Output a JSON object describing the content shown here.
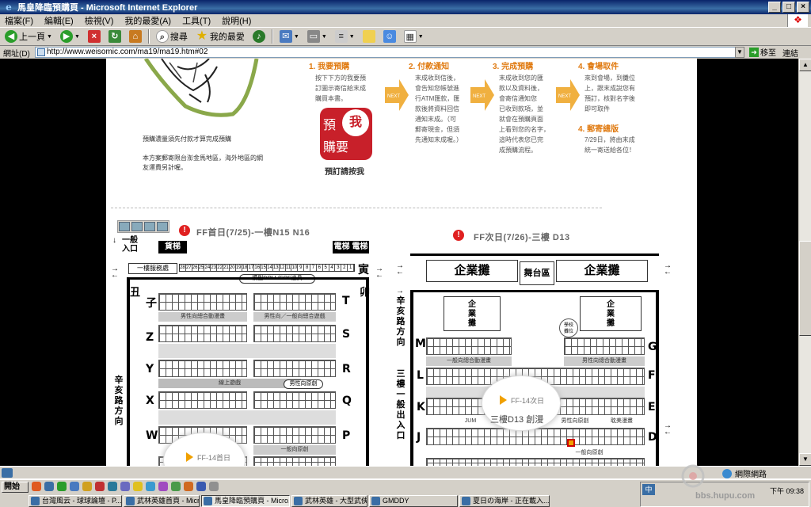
{
  "window": {
    "title": "馬皇降臨預購頁 - Microsoft Internet Explorer",
    "controls": [
      "_",
      "□",
      "×"
    ]
  },
  "menu": [
    "檔案(F)",
    "編輯(E)",
    "檢視(V)",
    "我的最愛(A)",
    "工具(T)",
    "說明(H)"
  ],
  "toolbar": {
    "back": "上一頁",
    "search": "搜尋",
    "favorites": "我的最愛"
  },
  "address": {
    "label": "網址(D)",
    "url": "http://www.weisomic.com/ma19/ma19.htm#02",
    "go": "移至",
    "links": "連結"
  },
  "page": {
    "note1": "預購濃量須先付款才算完成預購",
    "note2_lines": [
      "本方案郵寄限台澎金馬地區，海外地區的網",
      "友運費另計喔。"
    ],
    "steps": [
      {
        "title": "1. 我要預購",
        "lines": [
          "按下下方的我要預",
          "訂圖示寄信給末成",
          "購買本書。"
        ]
      },
      {
        "title": "2. 付款通知",
        "lines": [
          "末成收到信後，",
          "會告知您帳號進",
          "行ATM匯款，匯",
          "款後將資料回信",
          "通知末成。（可",
          "郵寄現金，但須",
          "先通知末成喔。）"
        ]
      },
      {
        "title": "3. 完成預購",
        "lines": [
          "末成收到您的匯",
          "款以及資料後，",
          "會寄信通知您",
          "已收到款項，並",
          "就會在預購頁面",
          "上看到您的名字，",
          "這時代表您已完",
          "成預購流程。"
        ]
      },
      {
        "title": "4. 會場取件",
        "lines": [
          "來到會場，到攤位",
          "上，跟末成說您有",
          "預訂，核對名字後",
          "即可取件"
        ]
      },
      {
        "title": "4. 郵寄總版",
        "lines": [
          "7/29日，將由末成",
          "統一寄送給各位！"
        ]
      }
    ],
    "next_label": "NEXT",
    "stamp": {
      "c1": "預",
      "c2": "我",
      "c3": "購要"
    },
    "stamp_caption": "預訂請按我",
    "floor1": {
      "warn": "!",
      "title": "FF首日(7/25)-一樓N15 N16",
      "entry": [
        "一般",
        "入口"
      ],
      "elevator1": "貨梯",
      "elevator2": "電梯 電梯",
      "service": "一樓服務處",
      "strip_nums": [
        "28",
        "27",
        "26",
        "25",
        "24",
        "23",
        "22",
        "21",
        "20",
        "19",
        "18",
        "17",
        "16",
        "15",
        "14",
        "13",
        "12",
        "11",
        "10",
        "9",
        "8",
        "7",
        "6",
        "5",
        "4",
        "3",
        "2",
        "1"
      ],
      "corner_left": "丑",
      "corner_right": "寅",
      "doll": "模型DOLL/COS道具",
      "street": "辛亥路方向",
      "rows_left": [
        "子",
        "Z",
        "Y",
        "X",
        "W"
      ],
      "rows_right": [
        "T",
        "S",
        "R",
        "Q",
        "P"
      ],
      "corner2": "卯",
      "zones": [
        "男性向總合動漫畫",
        "男性向／一般向總合遊戲",
        "線上遊戲",
        "男性向原創",
        "一般向原創"
      ],
      "callout_tag": "FF-14首日"
    },
    "floor2": {
      "warn": "!",
      "title": "FF次日(7/26)-三樓 D13",
      "biz": "企業攤",
      "stage": "舞台區",
      "biz_small": [
        "企",
        "業",
        "攤"
      ],
      "school": [
        "學校",
        "攤位"
      ],
      "street": "辛亥路方向",
      "entry": "三樓一般出入口",
      "rows_left": [
        "M",
        "L",
        "K",
        "J"
      ],
      "rows_right": [
        "G",
        "F",
        "E",
        "D"
      ],
      "zones": [
        "一般向總合動漫畫",
        "男性向總合動漫畫",
        "男性向原創",
        "耽美漫畫",
        "一般向原創",
        "JUM"
      ],
      "callout_tag": "FF-14次日",
      "callout_sub": "三樓D13 創漫"
    }
  },
  "status": {
    "zone": "網際網路"
  },
  "taskbar": {
    "start": "開始",
    "tasks": [
      "台灣風云 - 球球論壇 - P...",
      "武林英雄首頁 - Micro...",
      "馬皇降臨預購頁 - Micro...",
      "武林英雄 - 大型武俠網...",
      "GMDDY",
      "夏日の海岸 - 正在載入..."
    ],
    "clock": "下午 09:38"
  },
  "watermark": "bbs.hupu.com"
}
